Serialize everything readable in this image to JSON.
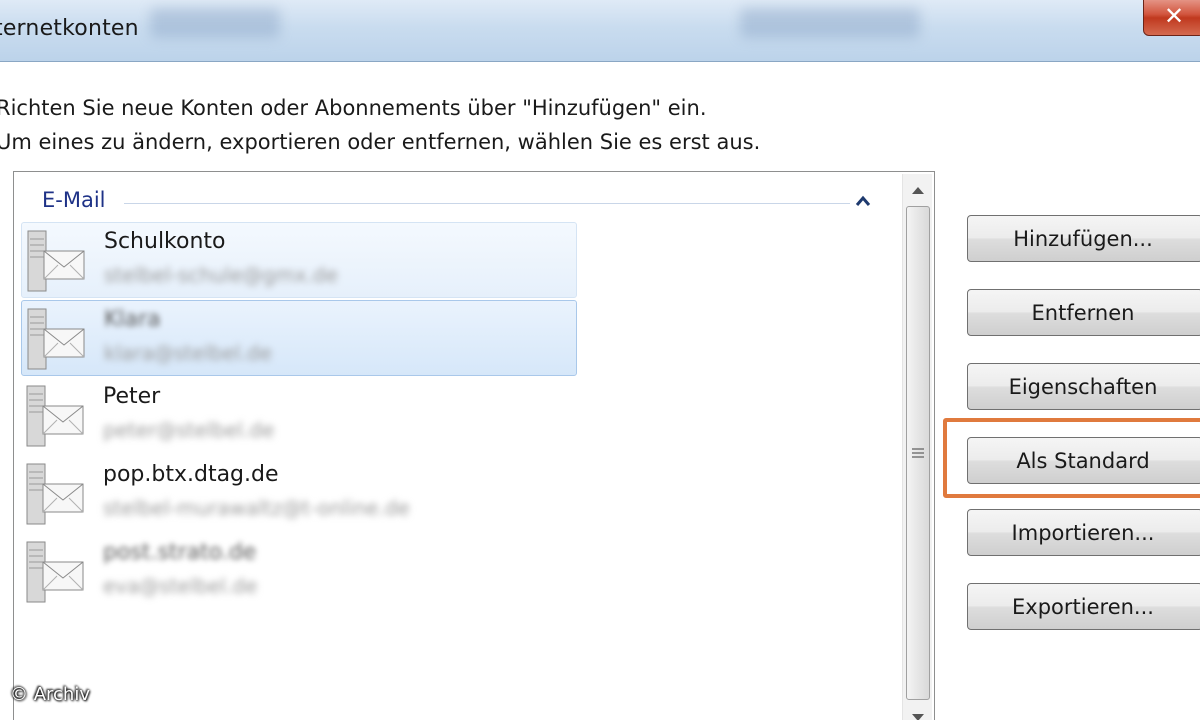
{
  "window": {
    "title": "ternetkonten",
    "close_label": "✕"
  },
  "instructions": {
    "line1": "Richten Sie neue Konten oder Abonnements über \"Hinzufügen\" ein.",
    "line2": "Um eines zu ändern, exportieren oder entfernen, wählen Sie es erst aus."
  },
  "accounts_list": {
    "group_label": "E-Mail",
    "items": [
      {
        "name": "Schulkonto",
        "detail": "stelbel-schule@gmx.de",
        "name_blurred": false,
        "state": "hover"
      },
      {
        "name": "Klara",
        "detail": "klara@stelbel.de",
        "name_blurred": true,
        "state": "selected"
      },
      {
        "name": "Peter",
        "detail": "peter@stelbel.de",
        "name_blurred": false,
        "state": "normal"
      },
      {
        "name": "pop.btx.dtag.de",
        "detail": "stelbel-murawaltz@t-online.de",
        "name_blurred": false,
        "state": "normal"
      },
      {
        "name": "post.strato.de",
        "detail": "eva@stelbel.de",
        "name_blurred": true,
        "state": "normal"
      }
    ]
  },
  "buttons": {
    "add": "Hinzufügen...",
    "remove": "Entfernen",
    "properties": "Eigenschaften",
    "set_default": "Als Standard",
    "import": "Importieren...",
    "export": "Exportieren..."
  },
  "credit": "© Archiv",
  "colors": {
    "highlight_frame": "#e07a3e",
    "group_label": "#1e3287"
  }
}
